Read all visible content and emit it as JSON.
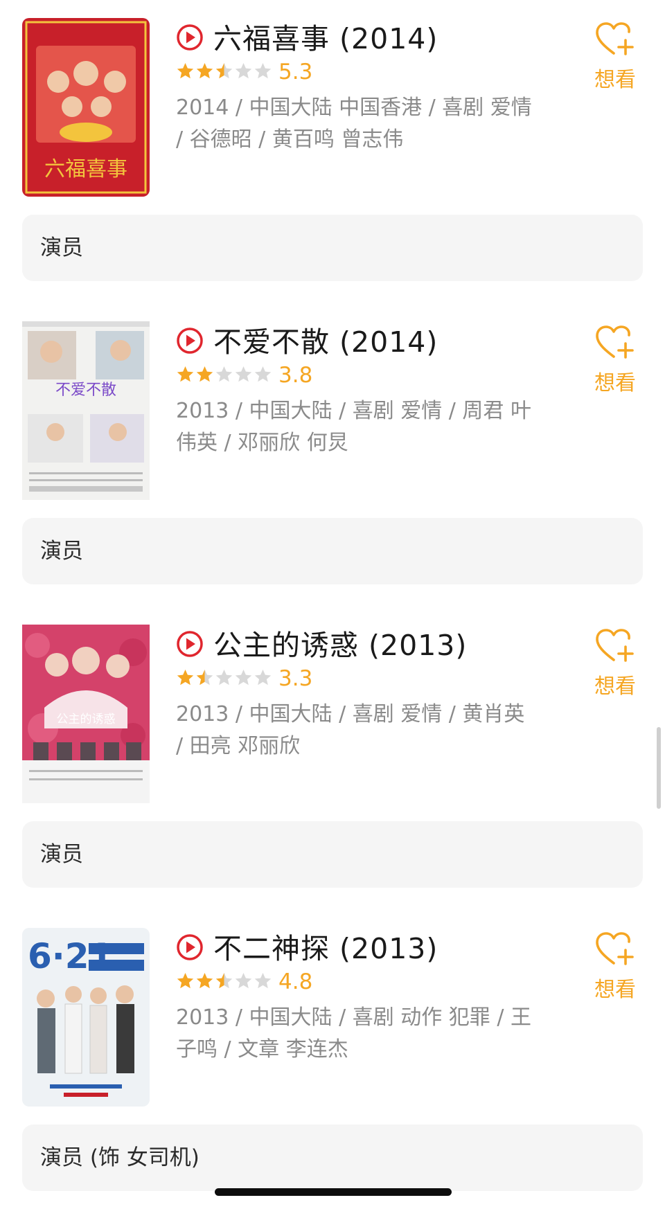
{
  "colors": {
    "accent": "#f5a623",
    "play": "#e0262e",
    "meta": "#8a8a8a",
    "bar": "#f5f5f5"
  },
  "icons": {
    "play": "play-circle-icon",
    "wish": "heart-plus-icon",
    "star": "star-icon"
  },
  "movies": [
    {
      "title": "六福喜事 (2014)",
      "rating": "5.3",
      "rating_value": 5.3,
      "stars": 2.5,
      "meta": "2014 / 中国大陆 中国香港 / 喜剧 爱情 / 谷德昭 / 黄百鸣 曾志伟",
      "wish": "想看",
      "role": "演员",
      "poster": {
        "bg": "#c8202a",
        "accent": "#f3c43d",
        "text": "六福喜事"
      }
    },
    {
      "title": "不爱不散 (2014)",
      "rating": "3.8",
      "rating_value": 3.8,
      "stars": 2,
      "meta": "2013 / 中国大陆 / 喜剧 爱情 / 周君 叶伟英 / 邓丽欣 何炅",
      "wish": "想看",
      "role": "演员",
      "poster": {
        "bg": "#f2f2f0",
        "accent": "#7b4ac8",
        "text": "不爱不散"
      }
    },
    {
      "title": "公主的诱惑 (2013)",
      "rating": "3.3",
      "rating_value": 3.3,
      "stars": 1.5,
      "meta": "2013 / 中国大陆 / 喜剧 爱情 / 黄肖英 / 田亮 邓丽欣",
      "wish": "想看",
      "role": "演员",
      "poster": {
        "bg": "#d4426a",
        "accent": "#ffffff",
        "text": "公主的诱惑"
      }
    },
    {
      "title": "不二神探 (2013)",
      "rating": "4.8",
      "rating_value": 4.8,
      "stars": 2.5,
      "meta": "2013 / 中国大陆 / 喜剧 动作 犯罪 / 王子鸣 / 文章 李连杰",
      "wish": "想看",
      "role": "演员 (饰 女司机)",
      "poster": {
        "bg": "#eef2f5",
        "accent": "#2a5fb0",
        "text": "6·21"
      }
    }
  ]
}
